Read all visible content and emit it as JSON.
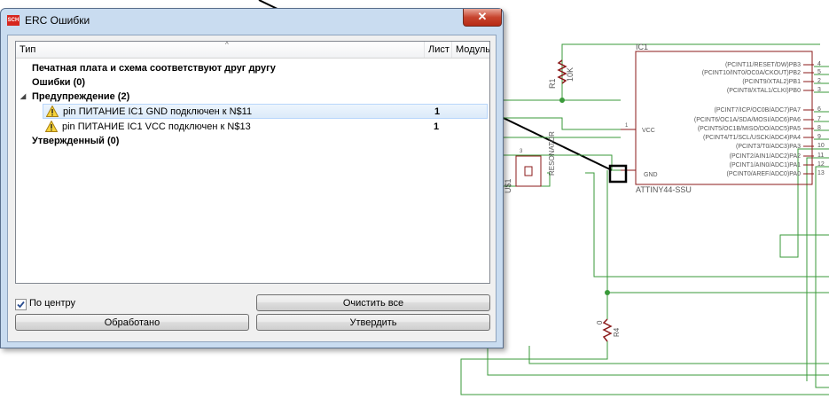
{
  "dialog": {
    "title": "ERC Ошибки",
    "icon_text": "SCH",
    "close_glyph": "✕",
    "columns": {
      "type": "Тип",
      "sheet": "Лист",
      "module": "Модуль"
    },
    "rows": [
      {
        "label": "Печатная плата и схема соответствуют друг другу"
      },
      {
        "label": "Ошибки (0)"
      },
      {
        "label": "Предупреждение (2)"
      },
      {
        "label": "pin ПИТАНИЕ IC1 GND подключен к N$11",
        "sheet": "1"
      },
      {
        "label": "pin ПИТАНИЕ IC1 VCC подключен к N$13",
        "sheet": "1"
      },
      {
        "label": "Утвержденный (0)"
      }
    ],
    "center_checkbox": {
      "label": "По центру",
      "checked": true
    },
    "buttons": {
      "clear_all": "Очистить все",
      "processed": "Обработано",
      "approve": "Утвердить"
    }
  },
  "schematic": {
    "ic_name": "IC1",
    "ic_part": "ATTINY44-SSU",
    "pins_right": [
      "(PCINT11/RESET/DW)PB3",
      "(PCINT10/INT0/OC0A/CKOUT)PB2",
      "(PCINT9/XTAL2)PB1",
      "(PCINT8/XTAL1/CLKI)PB0",
      "(PCINT7/ICP/OC0B/ADC7)PA7",
      "(PCINT6/OC1A/SDA/MOSI/ADC6)PA6",
      "(PCINT5/OC1B/MISO/DO/ADC5)PA5",
      "(PCINT4/T1/SCL/USCK/ADC4)PA4",
      "(PCINT3/T0/ADC3)PA3",
      "(PCINT2/AIN1/ADC2)PA2",
      "(PCINT1/AIN0/ADC1)PA1",
      "(PCINT0/AREF/ADC0)PA0"
    ],
    "pin_numbers": [
      "4",
      "5",
      "2",
      "3",
      "6",
      "7",
      "8",
      "9",
      "10",
      "11",
      "12",
      "13"
    ],
    "vcc_label": "VCC",
    "gnd_label": "GND",
    "pin1": "1",
    "r1_name": "R1",
    "r1_value": "10K",
    "resonator_label": "RESONATOR",
    "u1_label": "U$1",
    "res_pin3": "3",
    "r4_name": "R4",
    "r4_value": "0"
  }
}
